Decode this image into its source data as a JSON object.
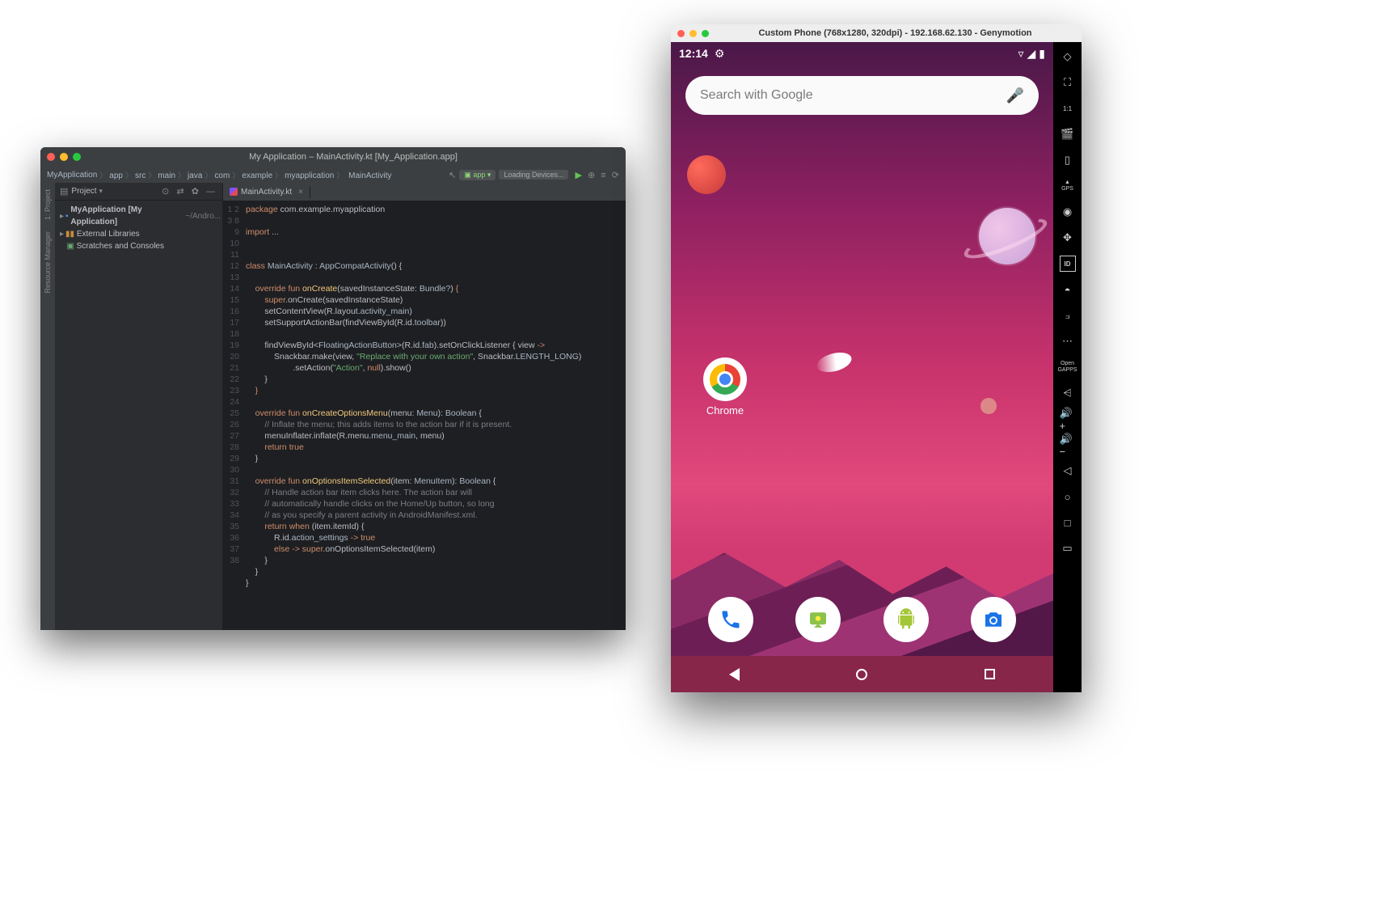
{
  "ide": {
    "title": "My Application – MainActivity.kt [My_Application.app]",
    "breadcrumbs": [
      "MyApplication",
      "app",
      "src",
      "main",
      "java",
      "com",
      "example",
      "myapplication",
      "MainActivity"
    ],
    "run_config": "app",
    "device_selector": "Loading Devices...",
    "project_panel_label": "Project",
    "tree": {
      "root": "MyApplication [My Application]",
      "root_hint": "~/Andro...",
      "ext_libs": "External Libraries",
      "scratches": "Scratches and Consoles"
    },
    "tab": "MainActivity.kt",
    "left_tabs": [
      "1: Project",
      "Resource Manager"
    ],
    "right_tabs": [],
    "code": {
      "lines": [
        1,
        2,
        3,
        8,
        9,
        10,
        11,
        12,
        13,
        14,
        15,
        16,
        17,
        18,
        19,
        20,
        21,
        22,
        23,
        24,
        25,
        26,
        27,
        28,
        29,
        30,
        31,
        32,
        33,
        34,
        35,
        36,
        37,
        38
      ]
    }
  },
  "emulator": {
    "window_title": "Custom Phone (768x1280, 320dpi) - 192.168.62.130 - Genymotion",
    "time": "12:14",
    "search_placeholder": "Search with Google",
    "home_app_label": "Chrome",
    "sidebar_open_gapps": "Open\nGAPPS"
  }
}
